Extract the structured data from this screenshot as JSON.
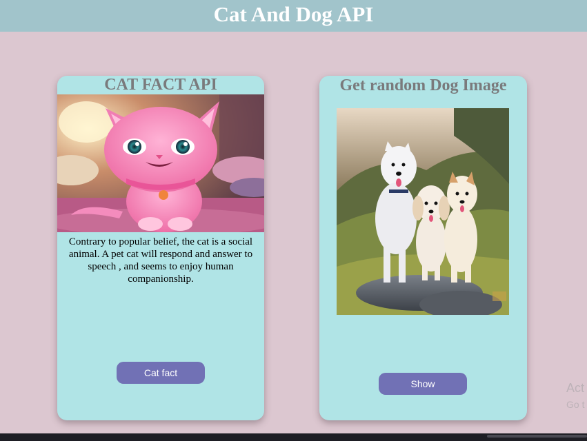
{
  "header": {
    "title": "Cat And Dog API",
    "background_color": "#a1c4cb"
  },
  "page": {
    "background_color": "#dcc7d0"
  },
  "cat_card": {
    "title": "CAT FACT API",
    "image_alt": "cute pink cartoon kitten",
    "fact": "Contrary to popular belief, the cat is a social animal. A pet cat will respond and answer to speech , and seems to enjoy human companionship.",
    "button_label": "Cat fact"
  },
  "dog_card": {
    "title": "Get random Dog Image",
    "image_alt": "three fluffy white dogs on a rock",
    "button_label": "Show"
  },
  "colors": {
    "card_background": "#b0e4e6",
    "button_background": "#7171b5",
    "title_color": "#7a7a7c"
  },
  "watermark": {
    "line1": "Act",
    "line2": "Go t"
  }
}
